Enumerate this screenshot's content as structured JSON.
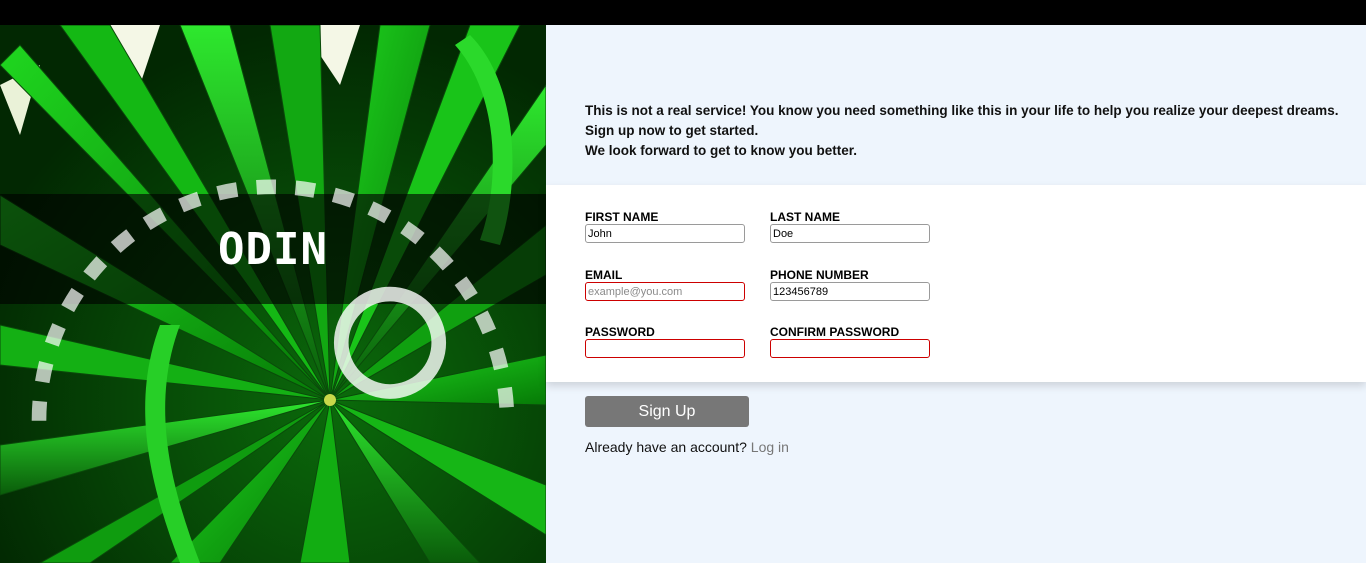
{
  "brand": {
    "logo_text": "ODIN"
  },
  "intro": {
    "line1": "This is not a real service! You know you need something like this in your life to help you realize your deepest dreams.",
    "line2": "Sign up now to get started.",
    "line3": "We look forward to get to know you better."
  },
  "form": {
    "first_name": {
      "label": "FIRST NAME",
      "value": "John",
      "placeholder": ""
    },
    "last_name": {
      "label": "LAST NAME",
      "value": "Doe",
      "placeholder": ""
    },
    "email": {
      "label": "EMAIL",
      "value": "",
      "placeholder": "example@you.com"
    },
    "phone": {
      "label": "PHONE NUMBER",
      "value": "123456789",
      "placeholder": ""
    },
    "password": {
      "label": "PASSWORD",
      "value": ""
    },
    "confirm_password": {
      "label": "CONFIRM PASSWORD",
      "value": ""
    }
  },
  "actions": {
    "signup_label": "Sign Up",
    "login_prompt": "Already have an account?",
    "login_link": "Log in"
  },
  "colors": {
    "content_bg": "#eef5fd",
    "invalid_border": "#cc0000",
    "button_bg": "#777777"
  }
}
